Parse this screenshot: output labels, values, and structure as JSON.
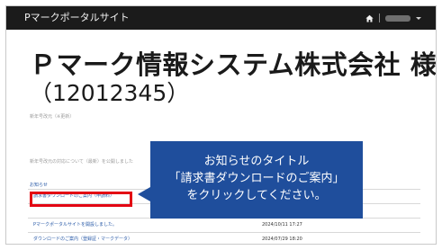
{
  "navbar": {
    "brand": "Pマークポータルサイト",
    "home_icon": "home-icon"
  },
  "company": {
    "name": "Ｐマーク情報システム株式会社 様",
    "id": "（12012345）"
  },
  "faint_lines": [
    "新年号改元（※更新）",
    "新年号改元の対応について（最新）を公開しました"
  ],
  "notices": {
    "heading": "お知らせ",
    "rows": [
      {
        "title": "請求書ダウンロードのご案内（申請料）",
        "date": ""
      },
      {
        "title": "",
        "date": ""
      },
      {
        "title": "Pマークポータルサイトを開設しました。",
        "date": "2024/10/11 17:27"
      },
      {
        "title": "ダウンロードのご案内（登録証・マークデータ）",
        "date": "2024/07/29 18:20"
      }
    ]
  },
  "callout": {
    "line1": "お知らせのタイトル",
    "line2": "「請求書ダウンロードのご案内」",
    "line3": "をクリックしてください。"
  },
  "colors": {
    "navbar": "#1b1b1b",
    "callout": "#1f4e9c",
    "highlight": "#e30613",
    "link": "#2a5ba8"
  }
}
